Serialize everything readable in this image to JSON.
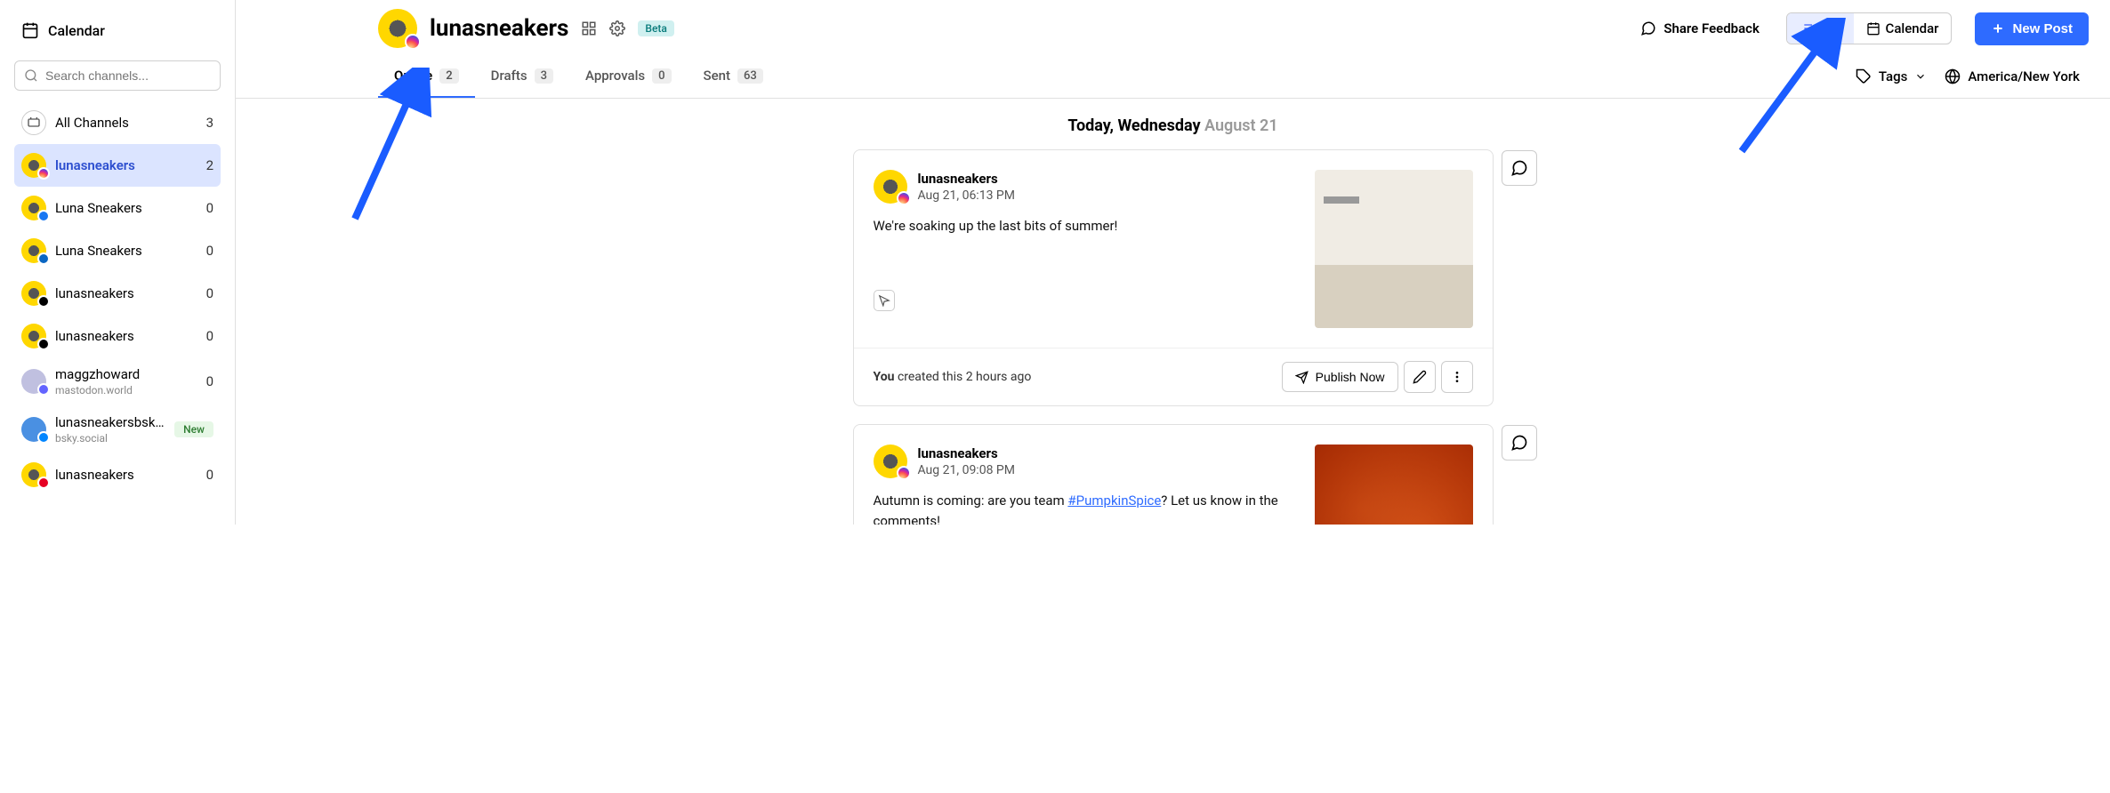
{
  "sidebar": {
    "calendar_label": "Calendar",
    "search_placeholder": "Search channels...",
    "all_channels_label": "All Channels",
    "all_channels_count": "3",
    "channels": [
      {
        "name": "lunasneakers",
        "count": "2",
        "network": "instagram"
      },
      {
        "name": "Luna Sneakers",
        "count": "0",
        "network": "facebook"
      },
      {
        "name": "Luna Sneakers",
        "count": "0",
        "network": "linkedin"
      },
      {
        "name": "lunasneakers",
        "count": "0",
        "network": "threads"
      },
      {
        "name": "lunasneakers",
        "count": "0",
        "network": "tiktok"
      },
      {
        "name": "maggzhoward",
        "sub": "mastodon.world",
        "count": "0",
        "network": "mastodon"
      },
      {
        "name": "lunasneakersbsky...",
        "sub": "bsky.social",
        "pill": "New",
        "network": "bluesky"
      },
      {
        "name": "lunasneakers",
        "count": "0",
        "network": "pinterest"
      }
    ]
  },
  "header": {
    "title": "lunasneakers",
    "beta": "Beta",
    "feedback": "Share Feedback",
    "list": "List",
    "calendar": "Calendar",
    "new_post": "New Post"
  },
  "tabs": {
    "queue": {
      "label": "Queue",
      "count": "2"
    },
    "drafts": {
      "label": "Drafts",
      "count": "3"
    },
    "approvals": {
      "label": "Approvals",
      "count": "0"
    },
    "sent": {
      "label": "Sent",
      "count": "63"
    },
    "tags": "Tags",
    "timezone": "America/New York"
  },
  "date_header": {
    "prefix": "Today, Wednesday",
    "suffix": "August 21"
  },
  "posts": [
    {
      "author": "lunasneakers",
      "time": "Aug 21, 06:13 PM",
      "text": "We're soaking up the last bits of summer!",
      "footer_you": "You",
      "footer_rest": " created this 2 hours ago",
      "publish": "Publish Now"
    },
    {
      "author": "lunasneakers",
      "time": "Aug 21, 09:08 PM",
      "text_a": "Autumn is coming: are you team ",
      "link": "#PumpkinSpice",
      "text_b": "? Let us know in the comments!"
    }
  ]
}
